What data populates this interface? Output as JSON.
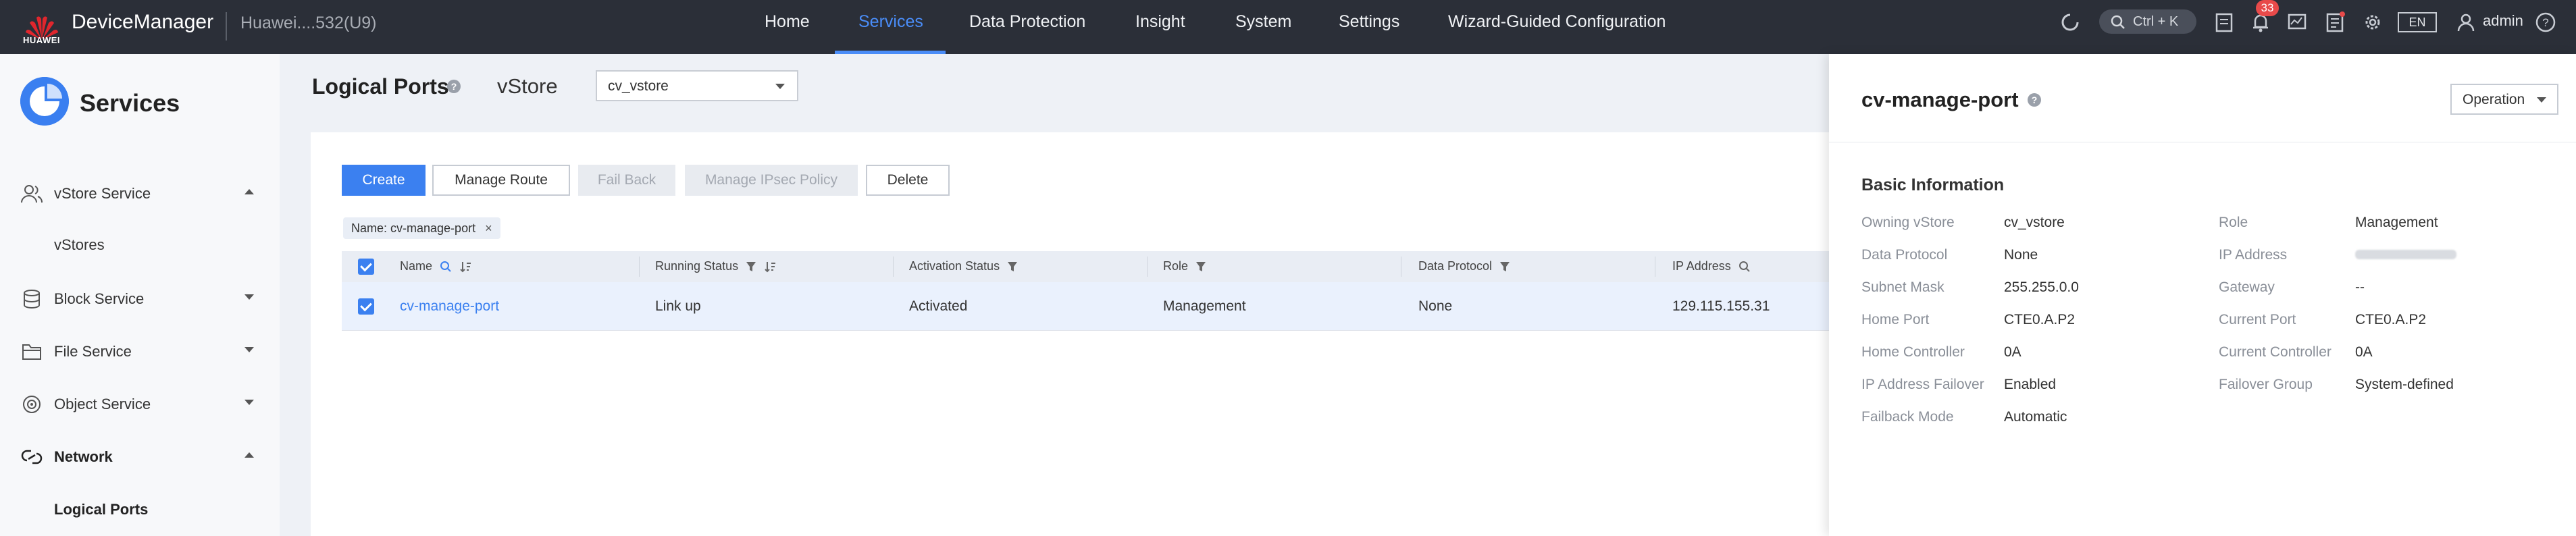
{
  "app": {
    "logo_text": "HUAWEI",
    "brand": "DeviceManager",
    "device_name": "Huawei....532(U9)"
  },
  "nav": {
    "items": [
      {
        "label": "Home",
        "active": false
      },
      {
        "label": "Services",
        "active": true
      },
      {
        "label": "Data Protection",
        "active": false
      },
      {
        "label": "Insight",
        "active": false
      },
      {
        "label": "System",
        "active": false
      },
      {
        "label": "Settings",
        "active": false
      },
      {
        "label": "Wizard-Guided Configuration",
        "active": false
      }
    ],
    "search_shortcut": "Ctrl + K",
    "alarm_count": "33",
    "language": "EN",
    "user": "admin",
    "icons": [
      "refresh-icon",
      "search-icon",
      "task-icon",
      "bell-icon",
      "monitor-icon",
      "list-icon",
      "gear-icon",
      "user-icon",
      "help-icon"
    ],
    "accent_color": "#4a8df8"
  },
  "sidebar": {
    "title": "Services",
    "items": [
      {
        "label": "vStore Service",
        "icon": "users-icon",
        "expanded": true
      },
      {
        "label": "vStores",
        "sub": true
      },
      {
        "label": "Block Service",
        "icon": "database-icon",
        "expanded": false
      },
      {
        "label": "File Service",
        "icon": "folder-icon",
        "expanded": false
      },
      {
        "label": "Object Service",
        "icon": "object-icon",
        "expanded": false
      },
      {
        "label": "Network",
        "icon": "network-icon",
        "expanded": true
      },
      {
        "label": "Logical Ports",
        "sub": true,
        "selected": true
      }
    ]
  },
  "main": {
    "page_title": "Logical Ports",
    "vstore_label": "vStore",
    "vstore_selected": "cv_vstore",
    "buttons": {
      "create": "Create",
      "manage_route": "Manage Route",
      "fail_back": "Fail Back",
      "manage_ipsec": "Manage IPsec Policy",
      "delete": "Delete"
    },
    "filter_chip": "Name: cv-manage-port",
    "table": {
      "columns": [
        "Name",
        "Running Status",
        "Activation Status",
        "Role",
        "Data Protocol",
        "IP Address"
      ],
      "rows": [
        {
          "name": "cv-manage-port",
          "running_status": "Link up",
          "activation_status": "Activated",
          "role": "Management",
          "data_protocol": "None",
          "ip_address": "129.115.155.31",
          "checked": true
        }
      ]
    }
  },
  "detail": {
    "title": "cv-manage-port",
    "operation_label": "Operation",
    "section": "Basic Information",
    "fields_left": [
      {
        "label": "Owning vStore",
        "value": "cv_vstore"
      },
      {
        "label": "Data Protocol",
        "value": "None"
      },
      {
        "label": "Subnet Mask",
        "value": "255.255.0.0"
      },
      {
        "label": "Home Port",
        "value": "CTE0.A.P2"
      },
      {
        "label": "Home Controller",
        "value": "0A"
      },
      {
        "label": "IP Address Failover",
        "value": "Enabled"
      },
      {
        "label": "Failback Mode",
        "value": "Automatic"
      }
    ],
    "fields_right": [
      {
        "label": "Role",
        "value": "Management"
      },
      {
        "label": "IP Address",
        "value": ""
      },
      {
        "label": "Gateway",
        "value": "--"
      },
      {
        "label": "Current Port",
        "value": "CTE0.A.P2"
      },
      {
        "label": "Current Controller",
        "value": "0A"
      },
      {
        "label": "Failover Group",
        "value": "System-defined"
      }
    ]
  }
}
